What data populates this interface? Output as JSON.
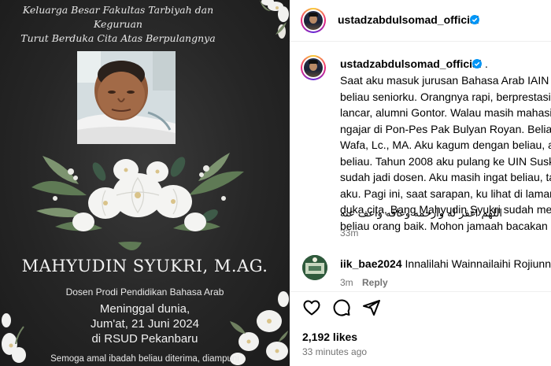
{
  "poster": {
    "heading_line1": "Keluarga Besar Fakultas Tarbiyah dan Keguruan",
    "heading_line2": "Turut Berduka Cita  Atas Berpulangnya",
    "name": "MAHYUDIN SYUKRI, M.AG.",
    "role": "Dosen Prodi Pendidikan Bahasa Arab",
    "death_line1": "Meninggal dunia,",
    "death_line2": "Jum'at, 21 Juni 2024",
    "death_line3": "di RSUD Pekanbaru",
    "prayer": "Semoga amal ibadah beliau diterima, diampuni"
  },
  "post": {
    "author": "ustadzabdulsomad_official",
    "caption_author": "ustadzabdulsomad_official",
    "caption_separator": ".",
    "caption": "Saat aku masuk jurusan Bahasa Arab IAIN Sus\nbeliau seniorku. Orangnya rapi, berprestasi. B\nlancar, alumni Gontor. Walau masih mahasisw\nngajar di Pon-Pes Pak Bulyan Royan. Beliau st\nWafa, Lc., MA. Aku kagum dengan beliau, aku\nbeliau. Tahun 2008 aku pulang ke UIN Suska,\nsudah jadi dosen. Aku masih ingat beliau, tap\naku. Pagi ini, saat sarapan, ku lihat di laman fl\nduka cita, Bang Mahyudin Syukri sudah menc\nbeliau orang baik. Mohon jamaah bacakan al",
    "caption_arabic": "اللهم اغفر له وارحمه وعافه واعف عنه",
    "caption_time": "33m",
    "comment": {
      "user": "iik_bae2024",
      "text": "Innalilahi Wainnailaihi Rojiunnnn",
      "time": "3m",
      "reply_label": "Reply"
    },
    "likes": "2,192 likes",
    "posted": "33 minutes ago"
  },
  "colors": {
    "verified": "#0095f6",
    "muted": "#737373",
    "poster_bg": "#262626"
  },
  "icons": [
    "verified-icon",
    "heart-icon",
    "comment-icon",
    "share-icon",
    "profile-photo-frame"
  ]
}
